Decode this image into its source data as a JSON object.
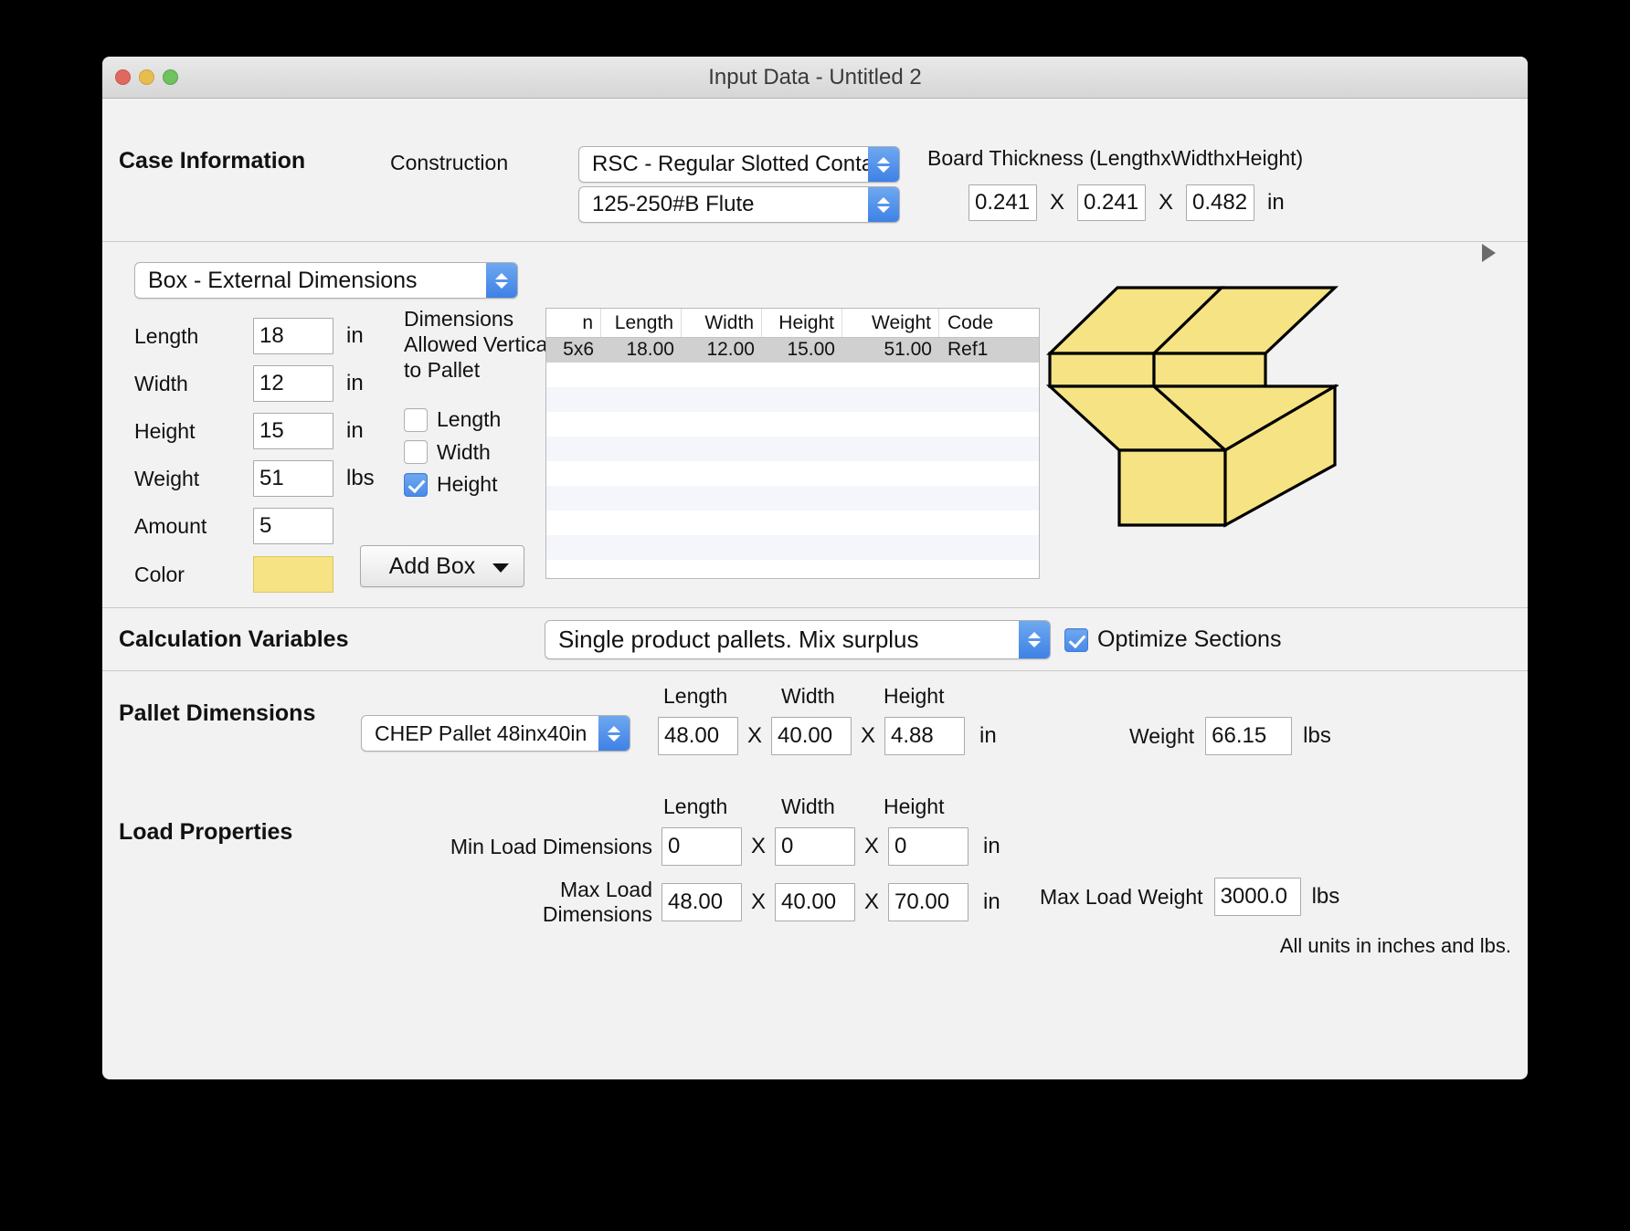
{
  "window": {
    "title": "Input Data - Untitled 2"
  },
  "case_information": {
    "heading": "Case Information",
    "construction_label": "Construction",
    "construction_value": "RSC - Regular Slotted Container",
    "flute_value": "125-250#B Flute",
    "board_thickness_label": "Board Thickness (LengthxWidthxHeight)",
    "thickness_length": "0.241",
    "thickness_width": "0.241",
    "thickness_height": "0.482",
    "thickness_unit": "in",
    "sep": "X"
  },
  "box_section": {
    "mode_value": "Box - External Dimensions",
    "fields": [
      {
        "label": "Length",
        "value": "18",
        "unit": "in"
      },
      {
        "label": "Width",
        "value": "12",
        "unit": "in"
      },
      {
        "label": "Height",
        "value": "15",
        "unit": "in"
      },
      {
        "label": "Weight",
        "value": "51",
        "unit": "lbs"
      },
      {
        "label": "Amount",
        "value": "5",
        "unit": ""
      }
    ],
    "color_label": "Color",
    "color_value": "#f6e383",
    "allowed_title": "Dimensions Allowed Vertical to Pallet",
    "allowed": [
      {
        "label": "Length",
        "checked": false
      },
      {
        "label": "Width",
        "checked": false
      },
      {
        "label": "Height",
        "checked": true
      }
    ],
    "add_button": "Add Box",
    "table": {
      "columns": [
        "n",
        "Length",
        "Width",
        "Height",
        "Weight",
        "Code"
      ],
      "rows": [
        [
          "5x6",
          "18.00",
          "12.00",
          "15.00",
          "51.00",
          "Ref1"
        ]
      ],
      "empty_rows": 9
    }
  },
  "calculation_variables": {
    "heading": "Calculation Variables",
    "strategy_value": "Single product pallets. Mix surplus",
    "optimize_label": "Optimize Sections",
    "optimize_checked": true
  },
  "pallet_dimensions": {
    "heading": "Pallet Dimensions",
    "pallet_value": "CHEP Pallet 48inx40in",
    "col_length": "Length",
    "col_width": "Width",
    "col_height": "Height",
    "length": "48.00",
    "width": "40.00",
    "height": "4.88",
    "unit": "in",
    "sep": "X",
    "weight_label": "Weight",
    "weight_value": "66.15",
    "weight_unit": "lbs"
  },
  "load_properties": {
    "heading": "Load Properties",
    "col_length": "Length",
    "col_width": "Width",
    "col_height": "Height",
    "min_label": "Min Load Dimensions",
    "min_length": "0",
    "min_width": "0",
    "min_height": "0",
    "max_label": "Max Load Dimensions",
    "max_length": "48.00",
    "max_width": "40.00",
    "max_height": "70.00",
    "unit": "in",
    "sep": "X",
    "max_weight_label": "Max Load Weight",
    "max_weight_value": "3000.0",
    "max_weight_unit": "lbs",
    "footnote": "All units in inches and lbs."
  }
}
